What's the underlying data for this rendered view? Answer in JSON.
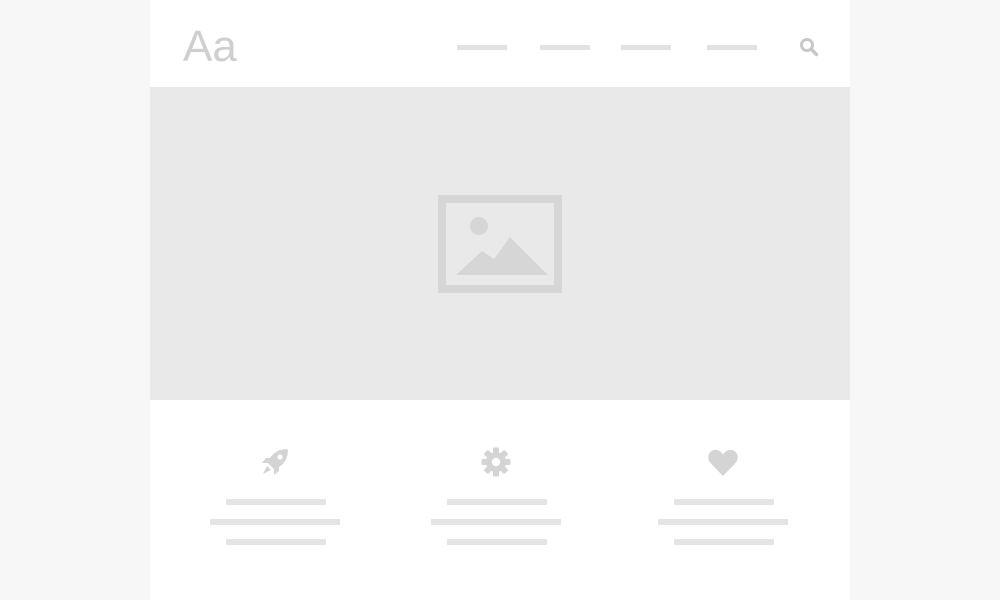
{
  "header": {
    "logo": "Aa",
    "nav_items": [
      "",
      "",
      "",
      ""
    ],
    "search_icon": "search-icon"
  },
  "hero": {
    "image_icon": "image-placeholder-icon"
  },
  "features": [
    {
      "icon": "rocket-icon"
    },
    {
      "icon": "gear-icon"
    },
    {
      "icon": "heart-icon"
    }
  ],
  "colors": {
    "page_background": "#f7f7f7",
    "content_background": "#ffffff",
    "hero_background": "#e9e9e9",
    "placeholder_gray": "#d6d6d6",
    "text_line_gray": "#e4e4e4"
  }
}
